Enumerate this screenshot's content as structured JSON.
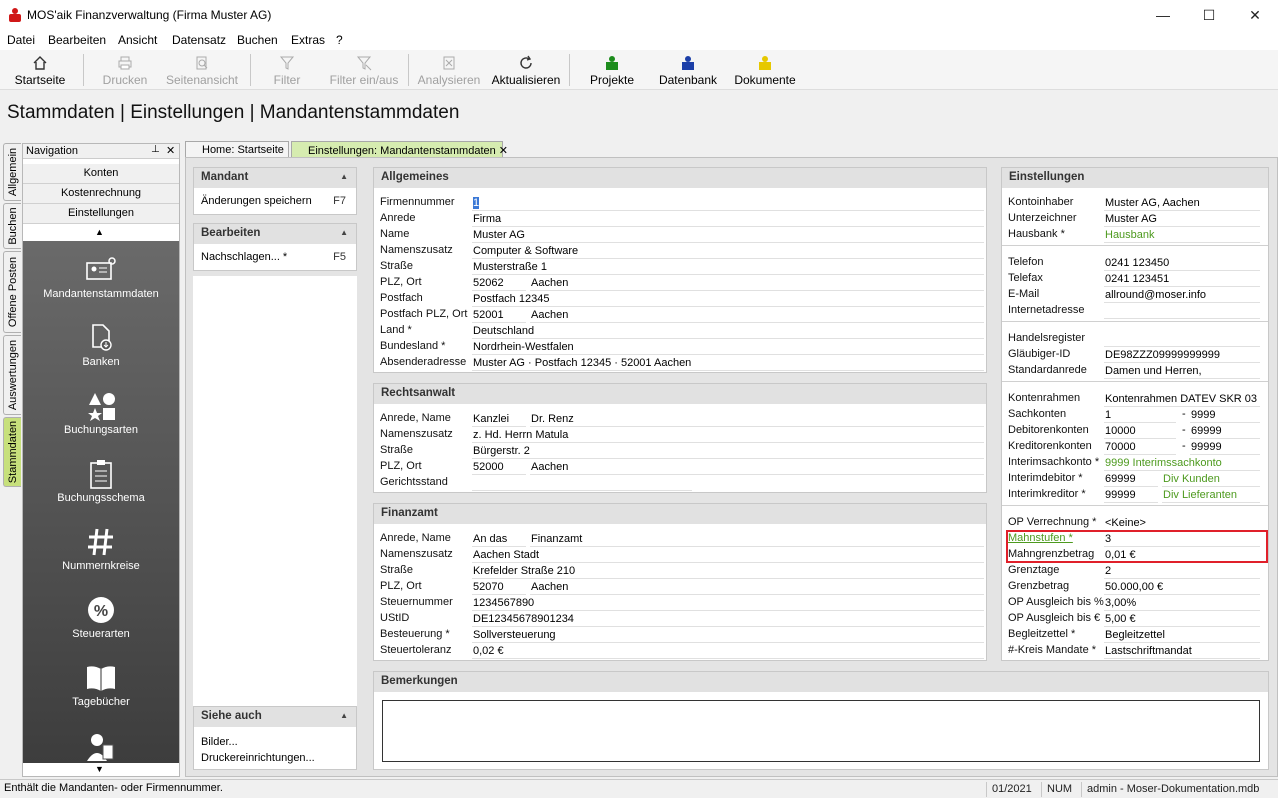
{
  "app": {
    "title": "MOS'aik Finanzverwaltung (Firma Muster AG)"
  },
  "window_controls": {
    "minimize": "—",
    "maximize": "☐",
    "close": "✕"
  },
  "menu": [
    "Datei",
    "Bearbeiten",
    "Ansicht",
    "Datensatz",
    "Buchen",
    "Extras",
    "?"
  ],
  "toolbar": [
    {
      "label": "Startseite",
      "icon": "home-icon",
      "enabled": true
    },
    {
      "label": "Drucken",
      "icon": "printer-icon",
      "enabled": false
    },
    {
      "label": "Seitenansicht",
      "icon": "print-preview-icon",
      "enabled": false
    },
    {
      "label": "Filter",
      "icon": "filter-icon",
      "enabled": false
    },
    {
      "label": "Filter ein/aus",
      "icon": "filter-toggle-icon",
      "enabled": false
    },
    {
      "label": "Analysieren",
      "icon": "analyze-icon",
      "enabled": false
    },
    {
      "label": "Aktualisieren",
      "icon": "refresh-icon",
      "enabled": true
    },
    {
      "label": "Projekte",
      "icon": "puzzle-green-icon",
      "enabled": true
    },
    {
      "label": "Datenbank",
      "icon": "puzzle-blue-icon",
      "enabled": true
    },
    {
      "label": "Dokumente",
      "icon": "puzzle-yellow-icon",
      "enabled": true
    }
  ],
  "page_title": "Stammdaten | Einstellungen | Mandantenstammdaten",
  "vertical_tabs": [
    "Allgemein",
    "Buchen",
    "Offene Posten",
    "Auswertungen",
    "Stammdaten"
  ],
  "navigation": {
    "title": "Navigation",
    "pin": "📌",
    "close": "✕",
    "groups": [
      "Konten",
      "Kostenrechnung",
      "Einstellungen"
    ],
    "items": [
      "Mandantenstammdaten",
      "Banken",
      "Buchungsarten",
      "Buchungsschema",
      "Nummernkreise",
      "Steuerarten",
      "Tagebücher"
    ]
  },
  "tabs": [
    "Home: Startseite",
    "Einstellungen: Mandantenstammdaten"
  ],
  "mandant": {
    "title": "Mandant",
    "item": "Änderungen speichern",
    "key": "F7"
  },
  "bearbeiten": {
    "title": "Bearbeiten",
    "item": "Nachschlagen... *",
    "key": "F5"
  },
  "siehe_auch": {
    "title": "Siehe auch",
    "items": [
      "Bilder...",
      "Druckereinrichtungen..."
    ]
  },
  "allgemeines": {
    "title": "Allgemeines",
    "rows": [
      {
        "label": "Firmennummer",
        "v1": "1"
      },
      {
        "label": "Anrede",
        "v1": "Firma"
      },
      {
        "label": "Name",
        "v1": "Muster AG"
      },
      {
        "label": "Namenszusatz",
        "v1": "Computer & Software"
      },
      {
        "label": "Straße",
        "v1": "Musterstraße 1"
      },
      {
        "label": "PLZ, Ort",
        "v1": "52062",
        "v2": "Aachen"
      },
      {
        "label": "Postfach",
        "v1": "Postfach 12345"
      },
      {
        "label": "Postfach PLZ, Ort",
        "v1": "52001",
        "v2": "Aachen"
      },
      {
        "label": "Land *",
        "v1": "Deutschland"
      },
      {
        "label": "Bundesland *",
        "v1": "Nordrhein-Westfalen"
      },
      {
        "label": "Absenderadresse",
        "v1": "Muster AG · Postfach 12345 · 52001 Aachen"
      }
    ]
  },
  "rechtsanwalt": {
    "title": "Rechtsanwalt",
    "rows": [
      {
        "label": "Anrede, Name",
        "v1": "Kanzlei",
        "v2": "Dr. Renz"
      },
      {
        "label": "Namenszusatz",
        "v1": "z. Hd. Herrn Matula"
      },
      {
        "label": "Straße",
        "v1": "Bürgerstr. 2"
      },
      {
        "label": "PLZ, Ort",
        "v1": "52000",
        "v2": "Aachen"
      },
      {
        "label": "Gerichtsstand",
        "v1": ""
      }
    ]
  },
  "finanzamt": {
    "title": "Finanzamt",
    "rows": [
      {
        "label": "Anrede, Name",
        "v1": "An das",
        "v2": "Finanzamt"
      },
      {
        "label": "Namenszusatz",
        "v1": "Aachen Stadt"
      },
      {
        "label": "Straße",
        "v1": "Krefelder Straße 210"
      },
      {
        "label": "PLZ, Ort",
        "v1": "52070",
        "v2": "Aachen"
      },
      {
        "label": "Steuernummer",
        "v1": "1234567890"
      },
      {
        "label": "UStID",
        "v1": "DE12345678901234"
      },
      {
        "label": "Besteuerung *",
        "v1": "Sollversteuerung"
      },
      {
        "label": "Steuertoleranz",
        "v1": "0,02 €"
      }
    ]
  },
  "bemerkungen": {
    "title": "Bemerkungen",
    "value": ""
  },
  "einstellungen": {
    "title": "Einstellungen",
    "bank": [
      {
        "label": "Kontoinhaber",
        "v1": "Muster AG, Aachen"
      },
      {
        "label": "Unterzeichner",
        "v1": "Muster AG"
      },
      {
        "label": "Hausbank *",
        "v1": "Hausbank"
      }
    ],
    "contact": [
      {
        "label": "Telefon",
        "v1": "0241 123450"
      },
      {
        "label": "Telefax",
        "v1": "0241 123451"
      },
      {
        "label": "E-Mail",
        "v1": "allround@moser.info"
      },
      {
        "label": "Internetadresse",
        "v1": ""
      }
    ],
    "register": [
      {
        "label": "Handelsregister",
        "v1": ""
      },
      {
        "label": "Gläubiger-ID",
        "v1": "DE98ZZZ09999999999"
      },
      {
        "label": "Standardanrede",
        "v1": " Damen und Herren,"
      }
    ],
    "konten": [
      {
        "label": "Kontenrahmen",
        "v1": "Kontenrahmen DATEV SKR 03"
      },
      {
        "label": "Sachkonten",
        "v1": "1",
        "v2": "9999"
      },
      {
        "label": "Debitorenkonten",
        "v1": "10000",
        "v2": "69999"
      },
      {
        "label": "Kreditorenkonten",
        "v1": "70000",
        "v2": "99999"
      },
      {
        "label": "Interimsachkonto *",
        "v1": "9999 Interimssachkonto"
      },
      {
        "label": "Interimdebitor *",
        "v1": "69999",
        "v2": "Div Kunden"
      },
      {
        "label": "Interimkreditor *",
        "v1": "99999",
        "v2": "Div Lieferanten"
      }
    ],
    "op": [
      {
        "label": "OP Verrechnung *",
        "v1": "<Keine>"
      },
      {
        "label": "Mahnstufen *",
        "v1": "3"
      },
      {
        "label": "Mahngrenzbetrag",
        "v1": "0,01 €"
      },
      {
        "label": "Grenztage",
        "v1": "2"
      },
      {
        "label": "Grenzbetrag",
        "v1": "50.000,00 €"
      },
      {
        "label": "OP Ausgleich bis %",
        "v1": "3,00%"
      },
      {
        "label": "OP Ausgleich bis €",
        "v1": "5,00 €"
      },
      {
        "label": "Begleitzettel *",
        "v1": "Begleitzettel"
      },
      {
        "label": "#-Kreis Mandate *",
        "v1": "Lastschriftmandat"
      }
    ],
    "dash": "-"
  },
  "highlight_color": "#e0202a",
  "accent_green": "#c7e07c",
  "status": {
    "message": "Enthält die Mandanten- oder Firmennummer.",
    "period": "01/2021",
    "num": "NUM",
    "db": "admin - Moser-Dokumentation.mdb"
  }
}
